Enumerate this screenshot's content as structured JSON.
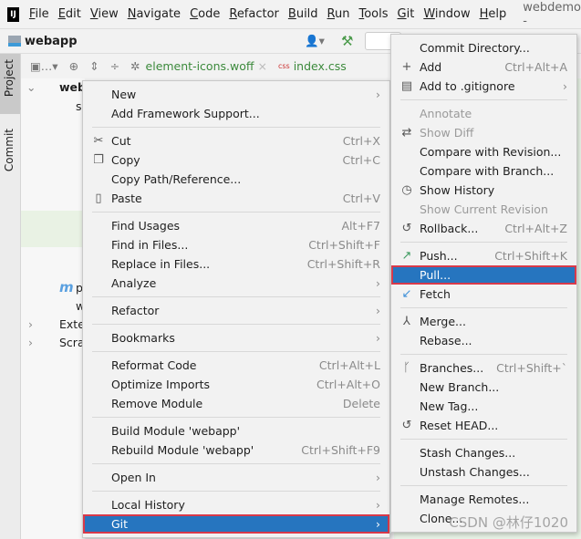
{
  "menubar": {
    "title": "webdemo -",
    "items": [
      "File",
      "Edit",
      "View",
      "Navigate",
      "Code",
      "Refactor",
      "Build",
      "Run",
      "Tools",
      "Git",
      "Window",
      "Help"
    ]
  },
  "toolbar": {
    "project_name": "webapp"
  },
  "left_stripe": {
    "project_tab": "Project",
    "commit_tab": "Commit"
  },
  "editor_tabs": [
    {
      "label": "element-icons.woff"
    },
    {
      "label": "index.css",
      "icon": "css"
    }
  ],
  "tree": {
    "root": "web",
    "items": [
      "s",
      "p",
      "w",
      "Exte",
      "Scra"
    ]
  },
  "context_menu": {
    "items": [
      {
        "label": "New",
        "submenu": true
      },
      {
        "label": "Add Framework Support..."
      },
      {
        "sep": true
      },
      {
        "label": "Cut",
        "icon": "scissors-icon",
        "glyph": "✂",
        "shortcut": "Ctrl+X"
      },
      {
        "label": "Copy",
        "icon": "copy-icon",
        "glyph": "❐",
        "shortcut": "Ctrl+C"
      },
      {
        "label": "Copy Path/Reference..."
      },
      {
        "label": "Paste",
        "icon": "paste-icon",
        "glyph": "▯",
        "shortcut": "Ctrl+V"
      },
      {
        "sep": true
      },
      {
        "label": "Find Usages",
        "shortcut": "Alt+F7"
      },
      {
        "label": "Find in Files...",
        "shortcut": "Ctrl+Shift+F"
      },
      {
        "label": "Replace in Files...",
        "shortcut": "Ctrl+Shift+R"
      },
      {
        "label": "Analyze",
        "submenu": true
      },
      {
        "sep": true
      },
      {
        "label": "Refactor",
        "submenu": true
      },
      {
        "sep": true
      },
      {
        "label": "Bookmarks",
        "submenu": true
      },
      {
        "sep": true
      },
      {
        "label": "Reformat Code",
        "shortcut": "Ctrl+Alt+L"
      },
      {
        "label": "Optimize Imports",
        "shortcut": "Ctrl+Alt+O"
      },
      {
        "label": "Remove Module",
        "shortcut": "Delete"
      },
      {
        "sep": true
      },
      {
        "label": "Build Module 'webapp'"
      },
      {
        "label": "Rebuild Module 'webapp'",
        "shortcut": "Ctrl+Shift+F9"
      },
      {
        "sep": true
      },
      {
        "label": "Open In",
        "submenu": true
      },
      {
        "sep": true
      },
      {
        "label": "Local History",
        "submenu": true
      },
      {
        "label": "Git",
        "submenu": true,
        "selected": true
      }
    ]
  },
  "git_menu": {
    "items": [
      {
        "label": "Commit Directory..."
      },
      {
        "label": "Add",
        "icon": "plus-icon",
        "glyph": "+",
        "shortcut": "Ctrl+Alt+A"
      },
      {
        "label": "Add to .gitignore",
        "icon": "gitignore-icon",
        "glyph": "▤",
        "submenu": true
      },
      {
        "sep": true
      },
      {
        "label": "Annotate",
        "disabled": true
      },
      {
        "label": "Show Diff",
        "icon": "diff-icon",
        "glyph": "⇄",
        "disabled": true
      },
      {
        "label": "Compare with Revision..."
      },
      {
        "label": "Compare with Branch..."
      },
      {
        "label": "Show History",
        "icon": "clock-icon",
        "glyph": "◷"
      },
      {
        "label": "Show Current Revision",
        "disabled": true
      },
      {
        "label": "Rollback...",
        "icon": "undo-icon",
        "glyph": "↺",
        "shortcut": "Ctrl+Alt+Z"
      },
      {
        "sep": true
      },
      {
        "label": "Push...",
        "icon": "push-arrow-icon",
        "glyph": "↗",
        "color": "#3c9a5f",
        "shortcut": "Ctrl+Shift+K"
      },
      {
        "label": "Pull...",
        "selected": true
      },
      {
        "label": "Fetch",
        "icon": "fetch-icon",
        "glyph": "↙",
        "color": "#3d8fd8"
      },
      {
        "sep": true
      },
      {
        "label": "Merge...",
        "icon": "merge-icon",
        "glyph": "⅄"
      },
      {
        "label": "Rebase..."
      },
      {
        "sep": true
      },
      {
        "label": "Branches...",
        "icon": "branch-icon",
        "glyph": "ᚴ",
        "shortcut": "Ctrl+Shift+`"
      },
      {
        "label": "New Branch..."
      },
      {
        "label": "New Tag..."
      },
      {
        "label": "Reset HEAD...",
        "icon": "undo-icon",
        "glyph": "↺"
      },
      {
        "sep": true
      },
      {
        "label": "Stash Changes..."
      },
      {
        "label": "Unstash Changes..."
      },
      {
        "sep": true
      },
      {
        "label": "Manage Remotes..."
      },
      {
        "label": "Clone..."
      }
    ]
  },
  "watermark": "CSDN @林仔1020",
  "colors": {
    "selection": "#2675bf",
    "highlight_border": "#d8394a",
    "menu_bg": "#f2f2f2"
  }
}
